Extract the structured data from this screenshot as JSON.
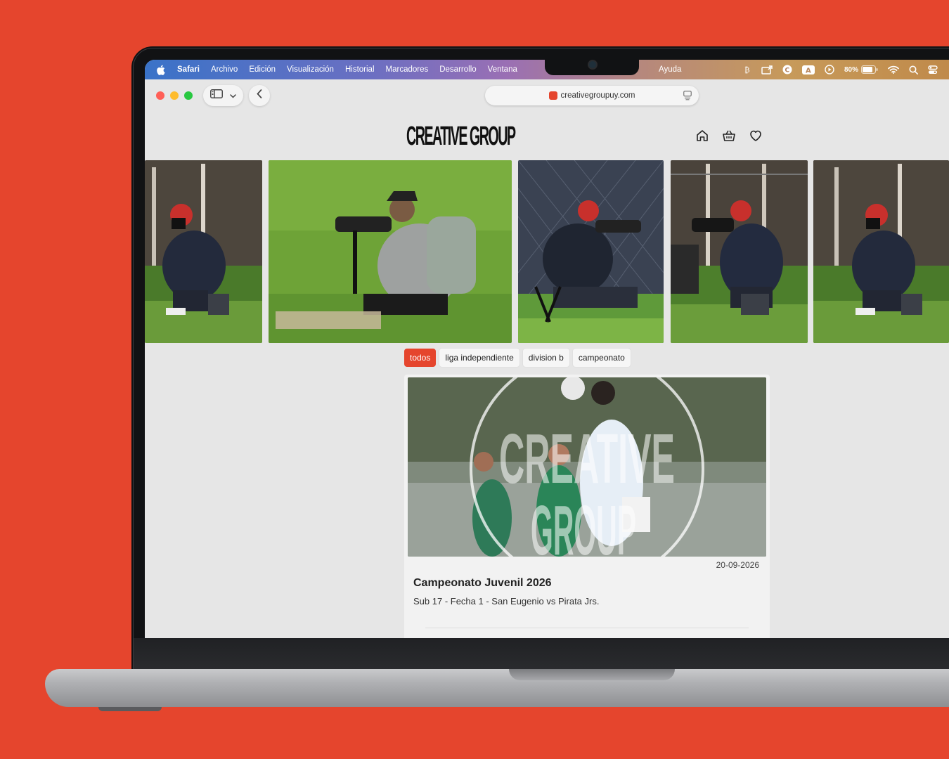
{
  "menubar": {
    "app": "Safari",
    "items": [
      "Archivo",
      "Edición",
      "Visualización",
      "Historial",
      "Marcadores",
      "Desarrollo",
      "Ventana"
    ],
    "help": "Ayuda",
    "battery": "80%"
  },
  "browser": {
    "url": "creativegroupuy.com"
  },
  "site": {
    "logo": "CREATIVE GROUP"
  },
  "filters": [
    "todos",
    "liga independiente",
    "division b",
    "campeonato"
  ],
  "card": {
    "watermark_top": "CREATIVE",
    "watermark_bottom": "GROUP",
    "date": "20-09-2026",
    "title": "Campeonato Juvenil 2026",
    "subtitle": "Sub 17 - Fecha 1 - San Eugenio vs Pirata Jrs."
  },
  "colors": {
    "background": "#e5452d",
    "accent": "#e5452d",
    "page": "#e6e6e6"
  }
}
